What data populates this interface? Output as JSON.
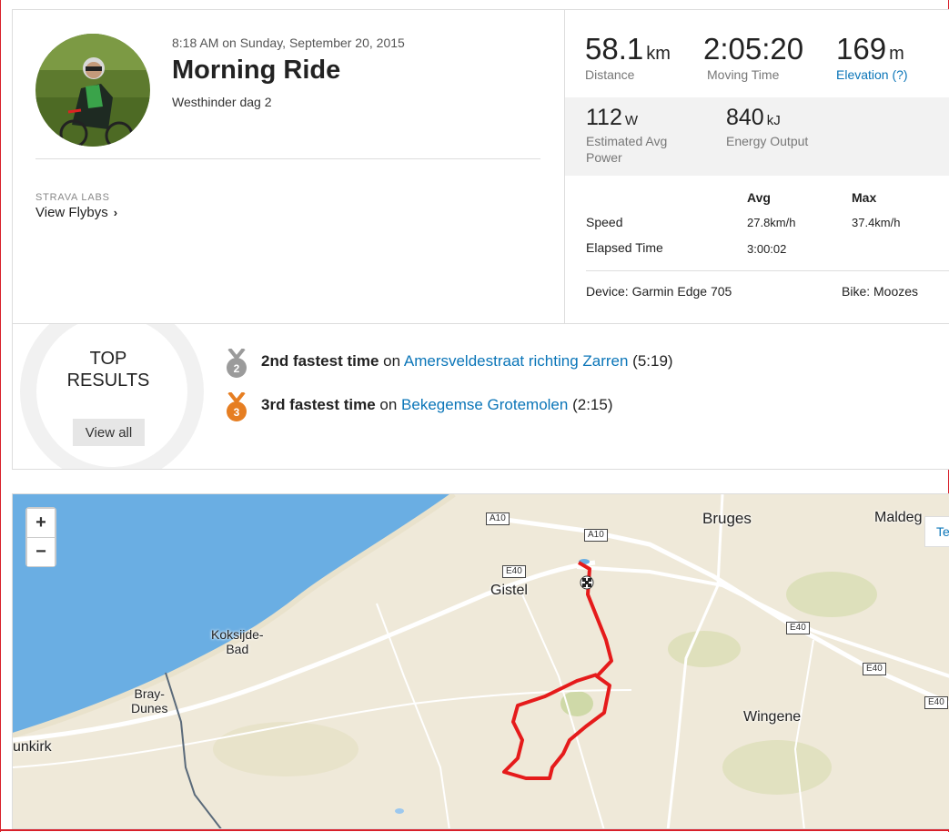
{
  "activity": {
    "datetime": "8:18 AM on Sunday, September 20, 2015",
    "title": "Morning Ride",
    "description": "Westhinder dag 2",
    "labs_label": "STRAVA LABS",
    "flyby_label": "View Flybys"
  },
  "stats": {
    "distance": {
      "value": "58.1",
      "unit": "km",
      "label": "Distance"
    },
    "moving_time": {
      "value": "2:05:20",
      "label": "Moving Time"
    },
    "elevation": {
      "value": "169",
      "unit": "m",
      "label": "Elevation (?)"
    },
    "power": {
      "value": "112",
      "unit": "W",
      "label": "Estimated Avg Power"
    },
    "energy": {
      "value": "840",
      "unit": "kJ",
      "label": "Energy Output"
    }
  },
  "table": {
    "headers": [
      "Avg",
      "Max"
    ],
    "rows": [
      {
        "label": "Speed",
        "avg": "27.8km/h",
        "max": "37.4km/h"
      },
      {
        "label": "Elapsed Time",
        "avg": "3:00:02",
        "max": ""
      }
    ],
    "device": "Device: Garmin Edge 705",
    "bike": "Bike: Moozes"
  },
  "top_results": {
    "title": "TOP RESULTS",
    "view_all": "View all",
    "items": [
      {
        "rank": "2",
        "prefix": "2nd fastest time",
        "on": " on ",
        "segment": "Amersveldestraat richting Zarren",
        "time": " (5:19)",
        "medal_color": "#9b9b9b"
      },
      {
        "rank": "3",
        "prefix": "3rd fastest time",
        "on": " on ",
        "segment": "Bekegemse Grotemolen",
        "time": " (2:15)",
        "medal_color": "#e67e22"
      }
    ]
  },
  "map": {
    "zoom_in": "+",
    "zoom_out": "−",
    "tab_label": "Te",
    "places": {
      "bruges": "Bruges",
      "maldeg": "Maldeg",
      "gistel": "Gistel",
      "koksijde": "Koksijde-\nBad",
      "bray": "Bray-\nDunes",
      "wingene": "Wingene",
      "dunkirk": "unkirk"
    },
    "roads": {
      "a10a": "A10",
      "a10b": "A10",
      "e40a": "E40",
      "e40b": "E40",
      "e40c": "E40",
      "e40d": "E40"
    },
    "route_color": "#e51b1b",
    "sea_color": "#6aaee3"
  }
}
